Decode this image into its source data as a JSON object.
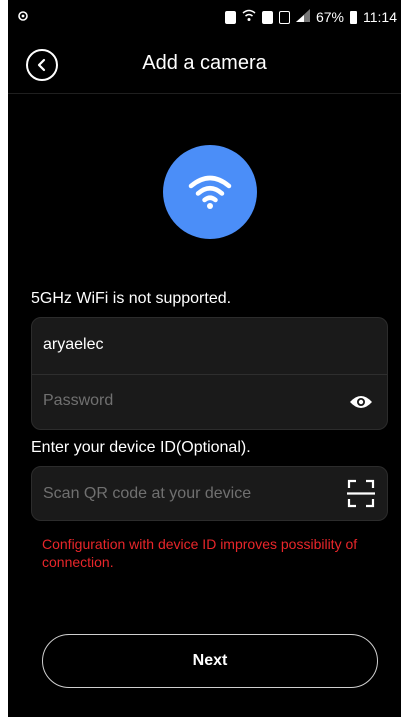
{
  "status_bar": {
    "battery": "67%",
    "time": "11:14"
  },
  "header": {
    "title": "Add a camera"
  },
  "wifi_note": "5GHz WiFi is not supported.",
  "wifi_form": {
    "ssid_value": "aryaelec",
    "password_placeholder": "Password"
  },
  "device_id": {
    "label": "Enter your device ID(Optional).",
    "placeholder": "Scan QR code at your device",
    "hint": "Configuration with device ID improves possibility of connection."
  },
  "footer": {
    "next_label": "Next"
  },
  "colors": {
    "background": "#000000",
    "accent": "#4b8ef8",
    "warning": "#e8262a"
  },
  "icons": [
    "settings-icon",
    "sim-lock-icon",
    "wifi-signal-icon",
    "sim-card-icon",
    "signal-icon",
    "battery-icon",
    "back-icon",
    "wifi-icon",
    "eye-icon",
    "scan-qr-icon"
  ]
}
